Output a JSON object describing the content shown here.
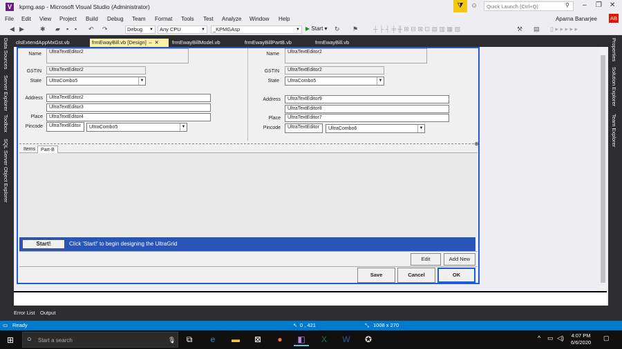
{
  "window": {
    "title": "kpmg.asp - Microsoft Visual Studio  (Administrator)",
    "quick_launch_placeholder": "Quick Launch (Ctrl+Q)",
    "user": "Aparna Banarjee",
    "avatar_initials": "AB"
  },
  "menu": [
    "File",
    "Edit",
    "View",
    "Project",
    "Build",
    "Debug",
    "Team",
    "Format",
    "Tools",
    "Test",
    "Analyze",
    "Window",
    "Help"
  ],
  "toolbar": {
    "config": "Debug",
    "platform": "Any CPU",
    "project": "_KPMGAsp",
    "start_label": "Start"
  },
  "left_rail": [
    "Data Sources",
    "Server Explorer",
    "Toolbox",
    "SQL Server Object Explorer"
  ],
  "right_rail": [
    "Properties",
    "Solution Explorer",
    "Team Explorer"
  ],
  "doc_tabs": [
    {
      "label": "clsExtendAppMxGst.vb",
      "active": false
    },
    {
      "label": "frmEwayBill.vb [Design]",
      "active": true
    },
    {
      "label": "frmEwayBillModel.vb",
      "active": false
    },
    {
      "label": "frmEwayBillPartB.vb",
      "active": false
    },
    {
      "label": "frmEwayBill.vb",
      "active": false
    }
  ],
  "form": {
    "left": {
      "name_label": "Name",
      "name_value": "UltraTextEditor2",
      "gstin_label": "GSTIN",
      "gstin_value": "UltraTextEditor2",
      "state_label": "State",
      "state_value": "UltraCombo5",
      "address_label": "Address",
      "address1": "UltraTextEditor2",
      "address2": "UltraTextEditor3",
      "place_label": "Place",
      "place_value": "UltraTextEditor4",
      "pincode_label": "Pincode",
      "pincode_value": "UltraTextEditor",
      "pincode_combo": "UltraCombo5"
    },
    "right": {
      "name_label": "Name",
      "name_value": "UltraTextEditor2",
      "gstin_label": "GSTIN",
      "gstin_value": "UltraTextEditor2",
      "state_label": "State",
      "state_value": "UltraCombo5",
      "address_label": "Address",
      "address1": "UltraTextEditor9",
      "address2": "UltraTextEditor8",
      "place_label": "Place",
      "place_value": "UltraTextEditor7",
      "pincode_label": "Pincode",
      "pincode_value": "UltraTextEditor",
      "pincode_combo": "UltraCombo6"
    },
    "tabs": [
      "Items",
      "Part-B"
    ],
    "grid_start_button": "Start!",
    "grid_start_message": "Click 'Start!' to begin designing the UltraGrid",
    "edit_button": "Edit",
    "add_new_button": "Add New",
    "save_button": "Save",
    "cancel_button": "Cancel",
    "ok_button": "OK"
  },
  "bottom_tabs": [
    "Error List",
    "Output"
  ],
  "status": {
    "ready": "Ready",
    "position": "0 , 421",
    "size": "1008 x 270"
  },
  "taskbar": {
    "search_placeholder": "Start a search",
    "time": "4:07 PM",
    "date": "6/6/2020"
  }
}
